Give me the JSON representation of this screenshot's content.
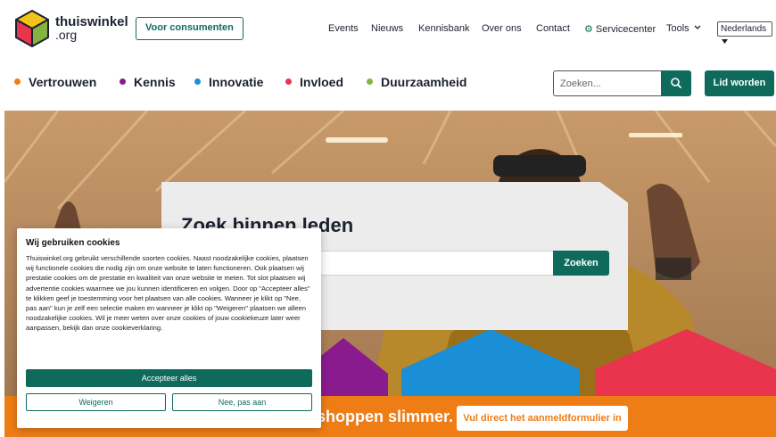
{
  "header": {
    "logo_name": "thuiswinkel",
    "logo_tld": ".org",
    "consumer_button": "Voor consumenten",
    "nav": [
      {
        "label": "Events"
      },
      {
        "label": "Nieuws"
      },
      {
        "label": "Kennisbank"
      },
      {
        "label": "Over ons"
      },
      {
        "label": "Contact"
      },
      {
        "label": "Servicecenter",
        "icon": "gear-icon"
      },
      {
        "label": "Tools",
        "icon": "chevron-down-icon"
      }
    ],
    "language": "Nederlands"
  },
  "pillars": [
    {
      "label": "Vertrouwen",
      "color": "#ef7d16"
    },
    {
      "label": "Kennis",
      "color": "#8a1b8f"
    },
    {
      "label": "Innovatie",
      "color": "#1b8fd6"
    },
    {
      "label": "Invloed",
      "color": "#e8344d"
    },
    {
      "label": "Duurzaamheid",
      "color": "#84b341"
    }
  ],
  "search": {
    "placeholder": "Zoeken...",
    "icon": "search-icon"
  },
  "join_button": "Lid worden",
  "hero": {
    "card_title": "Zoek binnen leden",
    "card_button": "Zoeken",
    "band_text": "shoppen slimmer.",
    "band_button": "Vul direct het aanmeldformulier in"
  },
  "cookie": {
    "title": "Wij gebruiken cookies",
    "body": "Thuiswinkel.org gebruikt verschillende soorten cookies. Naast noodzakelijke cookies, plaatsen wij functionele cookies die nodig zijn om onze website te laten functioneren. Ook plaatsen wij prestatie cookies om de prestatie en kwaliteit van onze website te meten. Tot slot plaatsen wij advertentie cookies waarmee we jou kunnen identificeren en volgen. Door op \"Accepteer alles\" te klikken geef je toestemming voor het plaatsen van alle cookies. Wanneer je klikt op \"Nee, pas aan\" kun je zelf een selectie maken en wanneer je klikt op \"Weigeren\" plaatsen we alleen noodzakelijke cookies. Wil je meer weten over onze cookies of jouw cookiekeuze later weer aanpassen, bekijk dan onze cookieverklaring.",
    "accept": "Accepteer alles",
    "decline": "Weigeren",
    "customize": "Nee, pas aan"
  },
  "colors": {
    "brand_green": "#0e6b5c",
    "orange": "#ef7d16",
    "purple": "#8a1b8f",
    "blue": "#1b8fd6",
    "red": "#e8344d",
    "green": "#84b341"
  }
}
